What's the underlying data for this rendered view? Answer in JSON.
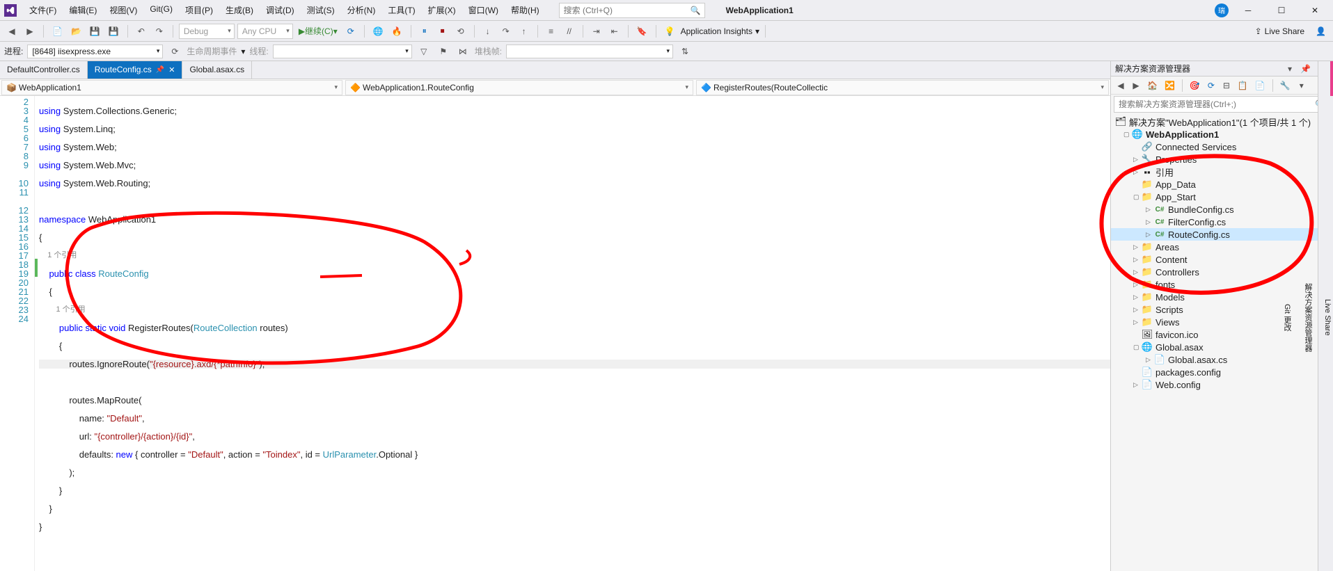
{
  "menu": {
    "file": "文件(F)",
    "edit": "编辑(E)",
    "view": "视图(V)",
    "git": "Git(G)",
    "project": "项目(P)",
    "build": "生成(B)",
    "debug": "调试(D)",
    "test": "测试(S)",
    "analyze": "分析(N)",
    "tools": "工具(T)",
    "extensions": "扩展(X)",
    "window": "窗口(W)",
    "help": "帮助(H)"
  },
  "search_placeholder": "搜索 (Ctrl+Q)",
  "app_name": "WebApplication1",
  "user_badge": "瑞",
  "toolbar": {
    "config": "Debug",
    "platform": "Any CPU",
    "continue": "继续(C)",
    "insights": "Application Insights",
    "live_share": "Live Share"
  },
  "toolbar2": {
    "process_label": "进程:",
    "process_value": "[8648] iisexpress.exe",
    "lifecycle": "生命周期事件",
    "thread": "线程:",
    "stack": "堆栈帧:"
  },
  "tabs": [
    {
      "label": "DefaultController.cs",
      "active": false
    },
    {
      "label": "RouteConfig.cs",
      "active": true
    },
    {
      "label": "Global.asax.cs",
      "active": false
    }
  ],
  "nav": {
    "scope": "WebApplication1",
    "class": "WebApplication1.RouteConfig",
    "member": "RegisterRoutes(RouteCollectic"
  },
  "code": {
    "lines": [
      "2",
      "3",
      "4",
      "5",
      "6",
      "7",
      "8",
      "9",
      "10",
      "11",
      "12",
      "13",
      "14",
      "15",
      "16",
      "17",
      "18",
      "19",
      "20",
      "21",
      "22",
      "23",
      "24"
    ]
  },
  "se": {
    "title": "解决方案资源管理器",
    "search_placeholder": "搜索解决方案资源管理器(Ctrl+;)",
    "sln": "解决方案\"WebApplication1\"(1 个项目/共 1 个)",
    "proj": "WebApplication1",
    "connected": "Connected Services",
    "properties": "Properties",
    "refs": "引用",
    "app_data": "App_Data",
    "app_start": "App_Start",
    "bundle": "BundleConfig.cs",
    "filter": "FilterConfig.cs",
    "route": "RouteConfig.cs",
    "areas": "Areas",
    "content": "Content",
    "controllers": "Controllers",
    "fonts": "fonts",
    "models": "Models",
    "scripts": "Scripts",
    "views": "Views",
    "favicon": "favicon.ico",
    "global": "Global.asax",
    "global_cs": "Global.asax.cs",
    "packages": "packages.config",
    "webconfig": "Web.config"
  },
  "rail": {
    "live_share": "Live Share",
    "se": "解决方案资源管理器",
    "git": "Git 更改"
  }
}
